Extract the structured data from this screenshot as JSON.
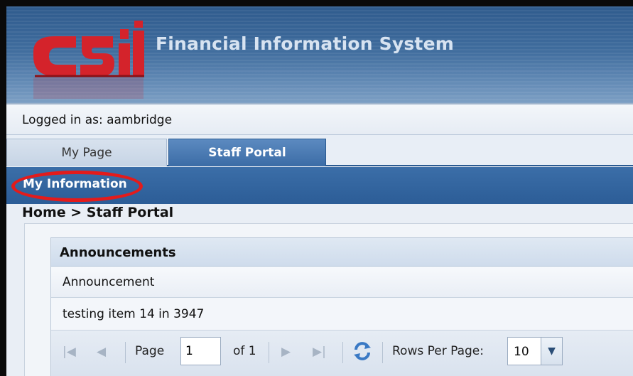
{
  "header": {
    "app_title": "Financial Information System",
    "logo_icon": "csii-logo-icon"
  },
  "user": {
    "logged_in_text": "Logged in as: aambridge"
  },
  "tabs": [
    {
      "label": "My Page",
      "active": false
    },
    {
      "label": "Staff Portal",
      "active": true
    }
  ],
  "subnav": {
    "item": "My Information",
    "highlight_color": "#e31b1b"
  },
  "breadcrumb": "Home > Staff Portal",
  "announcements": {
    "title": "Announcements",
    "column_header": "Announcement",
    "rows": [
      "testing item 14 in 3947"
    ]
  },
  "pager": {
    "first_icon": "first-page-icon",
    "prev_icon": "prev-page-icon",
    "next_icon": "next-page-icon",
    "last_icon": "last-page-icon",
    "refresh_icon": "refresh-icon",
    "page_label": "Page",
    "page_value": "1",
    "of_label": "of 1",
    "rows_label": "Rows Per Page:",
    "rows_value": "10"
  },
  "colors": {
    "header_blue": "#3f6c9d",
    "nav_blue": "#2c5d97",
    "logo_red": "#d4232b"
  }
}
